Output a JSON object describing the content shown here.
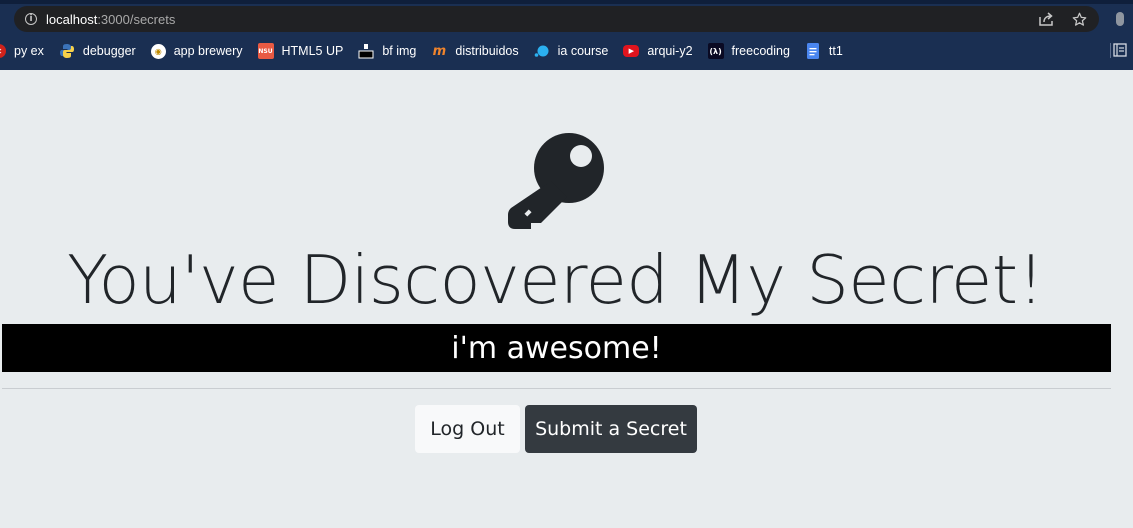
{
  "browser": {
    "url_host": "localhost",
    "url_path": ":3000/secrets",
    "bookmarks": [
      {
        "label": "py ex",
        "icon": "red-x-icon"
      },
      {
        "label": "debugger",
        "icon": "python-icon"
      },
      {
        "label": "app brewery",
        "icon": "app-brewery-icon"
      },
      {
        "label": "HTML5 UP",
        "icon": "html5up-icon"
      },
      {
        "label": "bf img",
        "icon": "bf-img-icon"
      },
      {
        "label": "distribuidos",
        "icon": "moodle-icon"
      },
      {
        "label": "ia course",
        "icon": "dots-icon"
      },
      {
        "label": "arqui-y2",
        "icon": "youtube-icon"
      },
      {
        "label": "freecoding",
        "icon": "freecodecamp-icon"
      },
      {
        "label": "tt1",
        "icon": "docs-icon"
      }
    ],
    "bookmark_html5up_badge": "NSU"
  },
  "page": {
    "title": "You've Discovered My Secret!",
    "secret": "i'm awesome!",
    "logout_label": "Log Out",
    "submit_label": "Submit a Secret"
  },
  "colors": {
    "chrome_bg": "#1a2f52",
    "page_bg": "#e8ecee",
    "secret_bar_bg": "#000000",
    "dark_button": "#343a40",
    "light_button": "#f8f9fa"
  }
}
